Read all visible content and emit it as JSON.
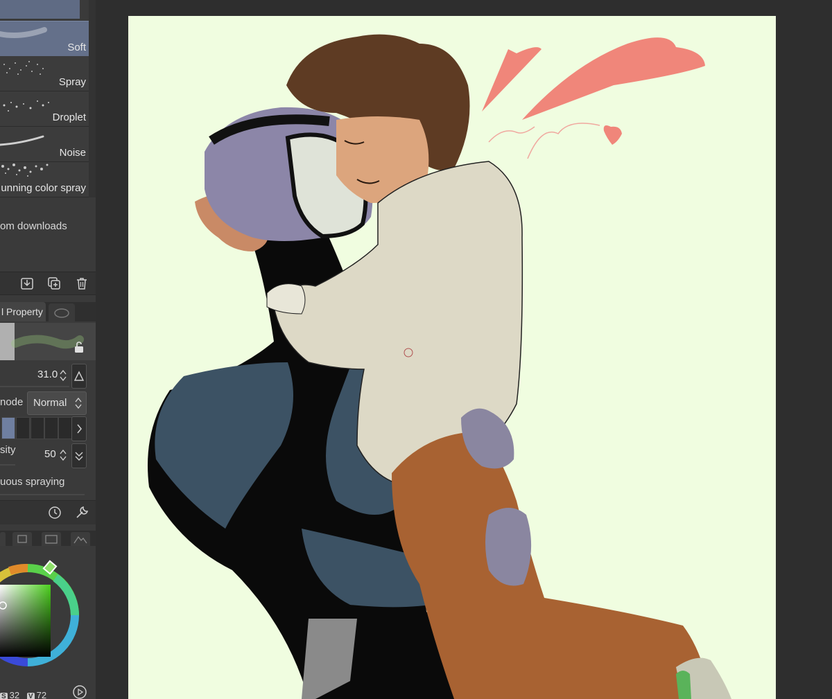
{
  "brushes": {
    "items": [
      {
        "label": "Soft",
        "selected": true
      },
      {
        "label": "Spray",
        "selected": false
      },
      {
        "label": "Droplet",
        "selected": false
      },
      {
        "label": "Noise",
        "selected": false
      },
      {
        "label": "unning color spray",
        "selected": false
      }
    ],
    "footer_link": "om downloads"
  },
  "brush_toolbar": {
    "icons": [
      "import-icon",
      "duplicate-icon",
      "trash-icon"
    ]
  },
  "tool_property": {
    "tab_label": "l Property",
    "brush_size": {
      "value": "31.0"
    },
    "blend_mode": {
      "label": "node",
      "value": "Normal"
    },
    "density": {
      "label": "sity",
      "value": "50"
    },
    "continuous_label": "uous spraying"
  },
  "color": {
    "current_hex": "#3f7a1f",
    "hsv_line": {
      "s_label": "S",
      "s_value": "32",
      "v_label": "V",
      "v_value": "72"
    }
  },
  "artwork": {
    "background": "#f0fde0",
    "heart_color": "#f0867a"
  }
}
